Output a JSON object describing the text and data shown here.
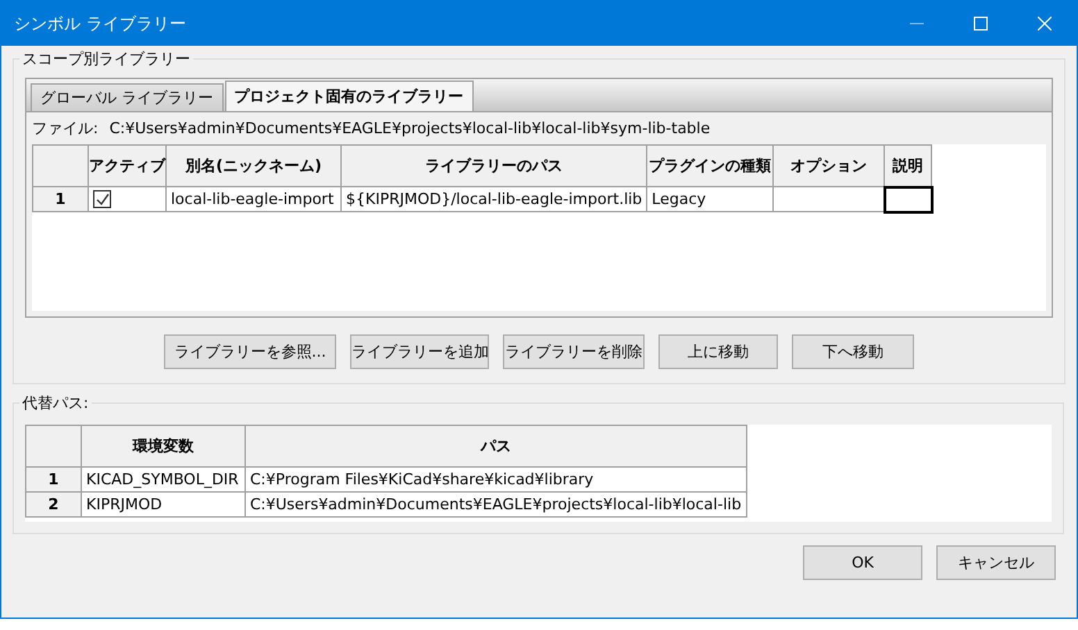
{
  "window": {
    "title": "シンボル ライブラリー"
  },
  "scope_group": {
    "label": "スコープ別ライブラリー",
    "tabs": [
      {
        "label": "グローバル ライブラリー",
        "selected": false
      },
      {
        "label": "プロジェクト固有のライブラリー",
        "selected": true
      }
    ],
    "file_label": "ファイル:",
    "file_path": "C:¥Users¥admin¥Documents¥EAGLE¥projects¥local-lib¥local-lib¥sym-lib-table",
    "columns": [
      "アクティブ",
      "別名(ニックネーム)",
      "ライブラリーのパス",
      "プラグインの種類",
      "オプション",
      "説明"
    ],
    "rows": [
      {
        "number": "1",
        "active": true,
        "nickname": "local-lib-eagle-import",
        "path": "${KIPRJMOD}/local-lib-eagle-import.lib",
        "plugin": "Legacy",
        "description_cursor": true
      }
    ],
    "buttons": [
      "ライブラリーを参照...",
      "ライブラリーを追加",
      "ライブラリーを削除",
      "上に移動",
      "下へ移動"
    ]
  },
  "paths_group": {
    "label": "代替パス:",
    "columns": [
      "環境変数",
      "パス"
    ],
    "rows": [
      {
        "number": "1",
        "name": "KICAD_SYMBOL_DIR",
        "path": "C:¥Program Files¥KiCad¥share¥kicad¥library"
      },
      {
        "number": "2",
        "name": "KIPRJMOD",
        "path": "C:¥Users¥admin¥Documents¥EAGLE¥projects¥local-lib¥local-lib"
      }
    ]
  },
  "dialog_buttons": [
    "OK",
    "キャンセル"
  ]
}
